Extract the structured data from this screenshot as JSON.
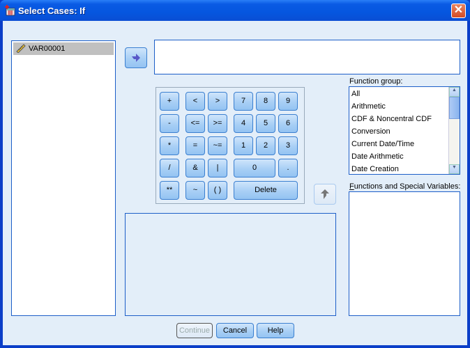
{
  "window": {
    "title": "Select Cases: If",
    "close_label": "✕"
  },
  "variables": [
    {
      "name": "VAR00001",
      "icon": "scale-ruler-icon",
      "selected": true
    }
  ],
  "expression": {
    "value": ""
  },
  "keypad": {
    "ops": [
      [
        "+",
        "<",
        ">"
      ],
      [
        "-",
        "<=",
        ">="
      ],
      [
        "*",
        "=",
        "~="
      ],
      [
        "/",
        "&",
        "|"
      ],
      [
        "**",
        "~",
        "( )"
      ]
    ],
    "digits": [
      [
        "7",
        "8",
        "9"
      ],
      [
        "4",
        "5",
        "6"
      ],
      [
        "1",
        "2",
        "3"
      ]
    ],
    "zero": "0",
    "dot": ".",
    "delete": "Delete"
  },
  "function_group": {
    "label_pre": "Function ",
    "label_ul": "g",
    "label_post": "roup:",
    "items": [
      "All",
      "Arithmetic",
      "CDF & Noncentral CDF",
      "Conversion",
      "Current Date/Time",
      "Date Arithmetic",
      "Date Creation"
    ]
  },
  "functions": {
    "label_ul": "F",
    "label_post": "unctions and Special Variables:",
    "items": []
  },
  "buttons": {
    "continue": "Continue",
    "cancel": "Cancel",
    "help": "Help"
  }
}
